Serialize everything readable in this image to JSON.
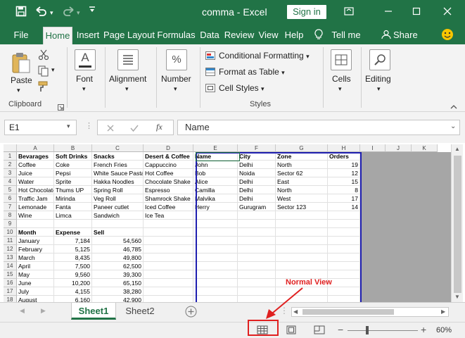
{
  "titlebar": {
    "title": "comma  -  Excel",
    "signin_label": "Sign in"
  },
  "tabs": [
    "File",
    "Home",
    "Insert",
    "Page Layout",
    "Formulas",
    "Data",
    "Review",
    "View",
    "Help"
  ],
  "tell_me": "Tell me",
  "share": "Share",
  "ribbon": {
    "clipboard_label": "Clipboard",
    "paste_label": "Paste",
    "font_label": "Font",
    "alignment_label": "Alignment",
    "number_label": "Number",
    "number_icon_text": "%",
    "font_icon_text": "A",
    "conditional_formatting": "Conditional Formatting",
    "format_as_table": "Format as Table",
    "cell_styles": "Cell Styles",
    "styles_label": "Styles",
    "cells_label": "Cells",
    "editing_label": "Editing"
  },
  "formula_bar": {
    "name_box": "E1",
    "fx": "fx",
    "value": "Name"
  },
  "columns": [
    "A",
    "B",
    "C",
    "D",
    "E",
    "F",
    "G",
    "H",
    "I",
    "J",
    "K"
  ],
  "rows": [
    "1",
    "2",
    "3",
    "4",
    "5",
    "6",
    "7",
    "8",
    "9",
    "10",
    "11",
    "12",
    "13",
    "14",
    "15",
    "16",
    "17",
    "18"
  ],
  "cells": {
    "r1": [
      "Bevarages",
      "Soft Drinks",
      "Snacks",
      "Desert & Coffee",
      "Name",
      "City",
      "Zone",
      "Orders"
    ],
    "r2": [
      "Coffee",
      "Coke",
      "French Fries",
      "Cappuccino",
      "John",
      "Delhi",
      "North",
      "19"
    ],
    "r3": [
      "Juice",
      "Pepsi",
      "White Sauce Pasta",
      "Hot Coffee",
      "Bob",
      "Noida",
      "Sector 62",
      "12"
    ],
    "r4": [
      "Water",
      "Sprite",
      "Hakka Noodles",
      "Chocolate Shake",
      "Alice",
      "Delhi",
      "East",
      "15"
    ],
    "r5": [
      "Hot Chocolate",
      "Thums UP",
      "Spring Roll",
      "Espresso",
      "Camilla",
      "Delhi",
      "North",
      "8"
    ],
    "r6": [
      "Traffic Jam",
      "Mirinda",
      "Veg Roll",
      "Shamrock Shake",
      "Malvika",
      "Delhi",
      "West",
      "17"
    ],
    "r7": [
      "Lemonade",
      "Fanta",
      "Paneer cutlet",
      "Iced Coffee",
      "Herry",
      "Gurugram",
      "Sector 123",
      "14"
    ],
    "r8": [
      "Wine",
      "Limca",
      "Sandwich",
      "Ice Tea"
    ],
    "r10": [
      "Month",
      "Expense",
      "Sell"
    ],
    "r11": [
      "January",
      "7,184",
      "54,560"
    ],
    "r12": [
      "February",
      "5,125",
      "46,785"
    ],
    "r13": [
      "March",
      "8,435",
      "49,800"
    ],
    "r14": [
      "April",
      "7,500",
      "62,500"
    ],
    "r15": [
      "May",
      "9,560",
      "39,300"
    ],
    "r16": [
      "June",
      "10,200",
      "65,150"
    ],
    "r17": [
      "July",
      "4,155",
      "38,280"
    ],
    "r18": [
      "August",
      "6,160",
      "42,900"
    ]
  },
  "sheets": [
    "Sheet1",
    "Sheet2"
  ],
  "status": {
    "zoom": "60%"
  },
  "annotation": "Normal View",
  "colors": {
    "brand": "#217346",
    "selection_border": "#1f1fb0",
    "annotation": "#e02020"
  }
}
